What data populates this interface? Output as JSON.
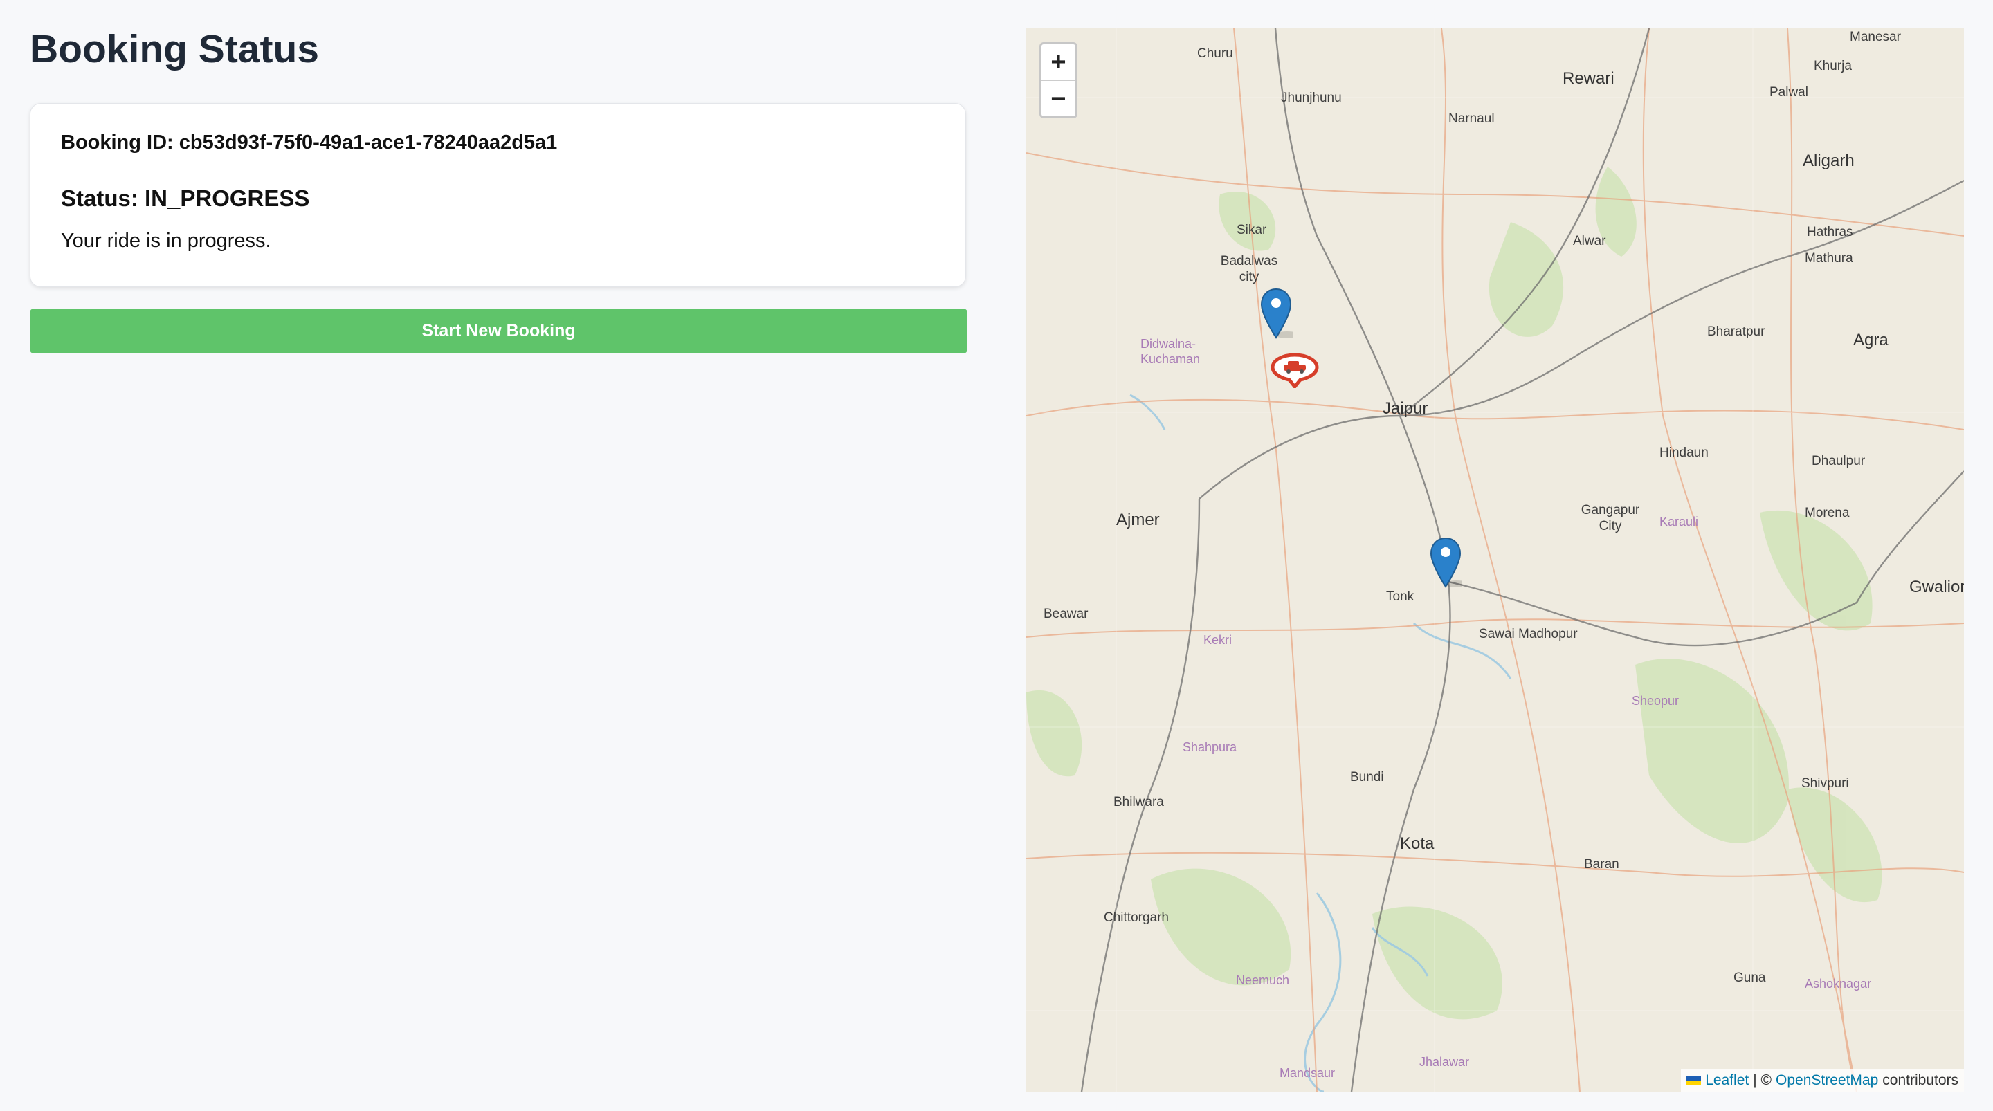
{
  "page": {
    "title": "Booking Status"
  },
  "booking": {
    "id_line": "Booking ID: cb53d93f-75f0-49a1-ace1-78240aa2d5a1",
    "status_line": "Status: IN_PROGRESS",
    "message": "Your ride is in progress."
  },
  "actions": {
    "new_booking_label": "Start New Booking"
  },
  "map": {
    "zoom_in": "+",
    "zoom_out": "−",
    "places": [
      {
        "name": "Manesar"
      },
      {
        "name": "Churu"
      },
      {
        "name": "Rewari"
      },
      {
        "name": "Khurja"
      },
      {
        "name": "Palwal"
      },
      {
        "name": "Jhunjhunu"
      },
      {
        "name": "Narnaul"
      },
      {
        "name": "Aligarh"
      },
      {
        "name": "Hathras"
      },
      {
        "name": "Alwar"
      },
      {
        "name": "Sikar"
      },
      {
        "name": "Badalwas city"
      },
      {
        "name": "Mathura"
      },
      {
        "name": "Bharatpur"
      },
      {
        "name": "Agra"
      },
      {
        "name": "Didwalna-Kuchaman"
      },
      {
        "name": "Jaipur"
      },
      {
        "name": "Hindaun"
      },
      {
        "name": "Dhaulpur"
      },
      {
        "name": "Ajmer"
      },
      {
        "name": "Gangapur City"
      },
      {
        "name": "Karauli"
      },
      {
        "name": "Morena"
      },
      {
        "name": "Tonk"
      },
      {
        "name": "Sawai Madhopur"
      },
      {
        "name": "Gwalior"
      },
      {
        "name": "Beawar"
      },
      {
        "name": "Kekri"
      },
      {
        "name": "Sheopur"
      },
      {
        "name": "Shahpura"
      },
      {
        "name": "Bundi"
      },
      {
        "name": "Bhilwara"
      },
      {
        "name": "Shivpuri"
      },
      {
        "name": "Kota"
      },
      {
        "name": "Baran"
      },
      {
        "name": "Chittorgarh"
      },
      {
        "name": "Neemuch"
      },
      {
        "name": "Guna"
      },
      {
        "name": "Ashoknagar"
      },
      {
        "name": "Jhalawar"
      },
      {
        "name": "Mandsaur"
      }
    ],
    "attribution": {
      "leaflet": "Leaflet",
      "separator": "| ©",
      "osm": "OpenStreetMap",
      "suffix": "contributors"
    }
  },
  "colors": {
    "button": "#5fc46a",
    "marker_blue": "#2a81cb",
    "car_marker": "#d63e2a",
    "link": "#0078a8"
  }
}
